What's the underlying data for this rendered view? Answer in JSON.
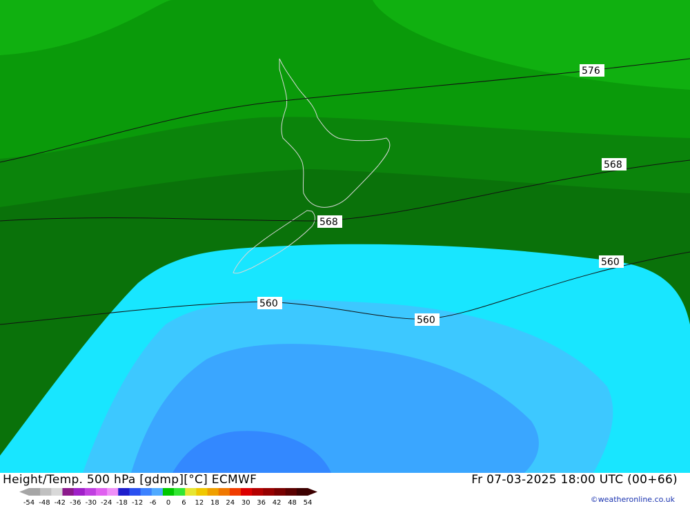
{
  "title": "Height/Temp. 500 hPa [gdmp][°C] ECMWF",
  "valid_time": "Fr 07-03-2025 18:00 UTC (00+66)",
  "credit": "©weatheronline.co.uk",
  "legend": {
    "ticks": [
      "-54",
      "-48",
      "-42",
      "-36",
      "-30",
      "-24",
      "-18",
      "-12",
      "-6",
      "0",
      "6",
      "12",
      "18",
      "24",
      "30",
      "36",
      "42",
      "48",
      "54"
    ],
    "colors": [
      "#a6a6a6",
      "#c0c0c0",
      "#d9d9d9",
      "#8b1a8b",
      "#a020c8",
      "#c040e0",
      "#e060f0",
      "#f090f8",
      "#1e1ecc",
      "#2a50f0",
      "#3c82ff",
      "#50aaff",
      "#00c800",
      "#32e632",
      "#e6e632",
      "#f0c800",
      "#f0a000",
      "#f07800",
      "#f03c00",
      "#dc0000",
      "#b40000",
      "#960000",
      "#780000",
      "#5a0000",
      "#3c0000"
    ]
  },
  "contour_labels": [
    "576",
    "568",
    "568",
    "560",
    "560",
    "560"
  ],
  "colors": {
    "green_light": "#10b010",
    "green_mid": "#0a9a0a",
    "green_dark": "#0b840b",
    "green_darker": "#0a720a",
    "cyan": "#18e6ff",
    "lightblue": "#3dc8ff",
    "blue": "#3aa6ff",
    "deepblue": "#3388ff"
  }
}
